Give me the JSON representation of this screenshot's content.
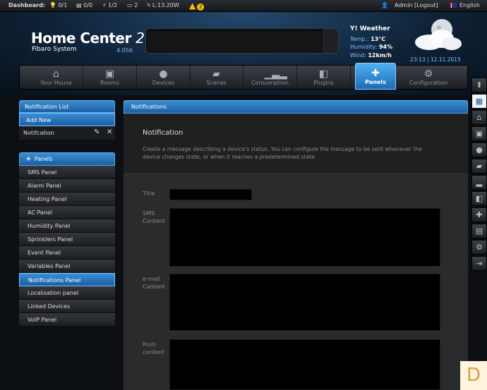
{
  "topbar": {
    "dashboard": "Dashboard:",
    "lights": "0/1",
    "blinds": "0/0",
    "power_devices": "1/2",
    "rooms": "2",
    "power": "L:13.20W",
    "alerts": "2",
    "user": "Admin",
    "logout": "[Logout]",
    "language": "English"
  },
  "logo": {
    "title": "Home Center",
    "title_suffix": "2",
    "subtitle": "Fibaro System",
    "version": "4.056"
  },
  "weather": {
    "label": "Weather",
    "temp_label": "Temp.:",
    "temp": "13°C",
    "humidity_label": "Humidity:",
    "humidity": "94%",
    "wind_label": "Wind:",
    "wind": "12km/h",
    "datetime": "23:13 | 12.11.2015"
  },
  "nav": {
    "tabs": [
      {
        "label": "Your House",
        "icon": "house-icon"
      },
      {
        "label": "Rooms",
        "icon": "rooms-icon"
      },
      {
        "label": "Devices",
        "icon": "bulb-icon"
      },
      {
        "label": "Scenes",
        "icon": "clapper-icon"
      },
      {
        "label": "Consumption",
        "icon": "chart-icon"
      },
      {
        "label": "Plugins",
        "icon": "plugin-icon"
      },
      {
        "label": "Panels",
        "icon": "puzzle-icon"
      },
      {
        "label": "Configuration",
        "icon": "gears-icon"
      }
    ]
  },
  "left": {
    "notification_list": "Notification List",
    "add_new": "Add New",
    "item": "Notifcation",
    "panels_title": "Panels",
    "panels": [
      "SMS Panel",
      "Alarm Panel",
      "Heating Panel",
      "AC Panel",
      "Humidity Panel",
      "Sprinklers Panel",
      "Event Panel",
      "Variables Panel",
      "Notifications Panel",
      "Localisation panel",
      "Linked Devices",
      "VoIP Panel"
    ]
  },
  "main": {
    "header": "Notifications",
    "title": "Notification",
    "description": "Create a message describing a device's status. You can configure the message to be sent whenever the device changes state, or when it reaches a predetermined state.",
    "title_label": "Title",
    "sms_label_1": "SMS",
    "sms_label_2": "Content",
    "email_label_1": "e-mail",
    "email_label_2": "Content",
    "push_label_1": "Push",
    "push_label_2": "content"
  },
  "side_icons": [
    "arrow-up-icon",
    "calendar-icon",
    "house-icon",
    "rooms-icon",
    "bulb-icon",
    "clapper-icon",
    "chart-icon",
    "plugin-icon",
    "puzzle-icon",
    "clipboard-icon",
    "gears-icon",
    "exit-icon"
  ],
  "badge": "D",
  "colors": {
    "accent": "#2a7ec9",
    "background": "#0c0f13",
    "main_panel": "#2a2b2d"
  }
}
